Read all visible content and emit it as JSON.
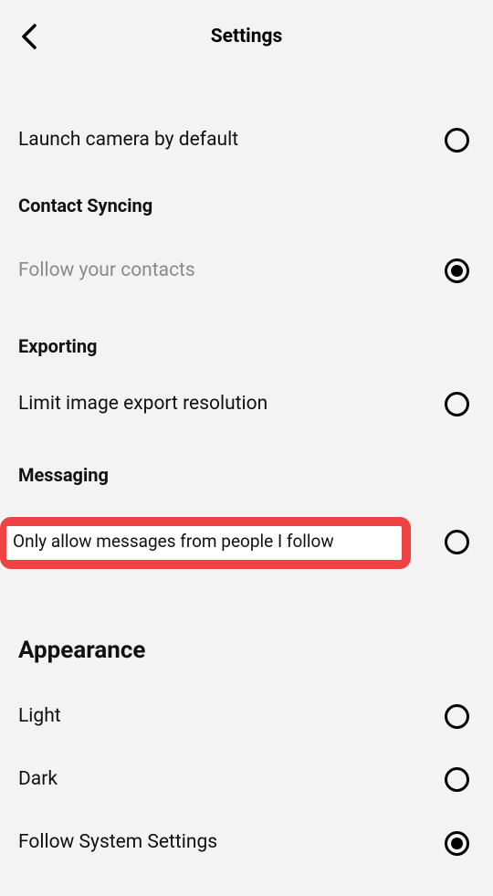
{
  "header": {
    "title": "Settings"
  },
  "top_items": {
    "launch_camera": {
      "label": "Launch camera by default",
      "selected": false
    }
  },
  "sections": {
    "contact_syncing": {
      "title": "Contact Syncing",
      "follow_contacts": {
        "label": "Follow your contacts",
        "selected": true
      }
    },
    "exporting": {
      "title": "Exporting",
      "limit_export": {
        "label": "Limit image export resolution",
        "selected": false
      }
    },
    "messaging": {
      "title": "Messaging",
      "only_followed": {
        "label": "Only allow messages from people I follow",
        "selected": false
      }
    },
    "appearance": {
      "title": "Appearance",
      "light": {
        "label": "Light",
        "selected": false
      },
      "dark": {
        "label": "Dark",
        "selected": false
      },
      "follow_system": {
        "label": "Follow System Settings",
        "selected": true
      }
    }
  }
}
